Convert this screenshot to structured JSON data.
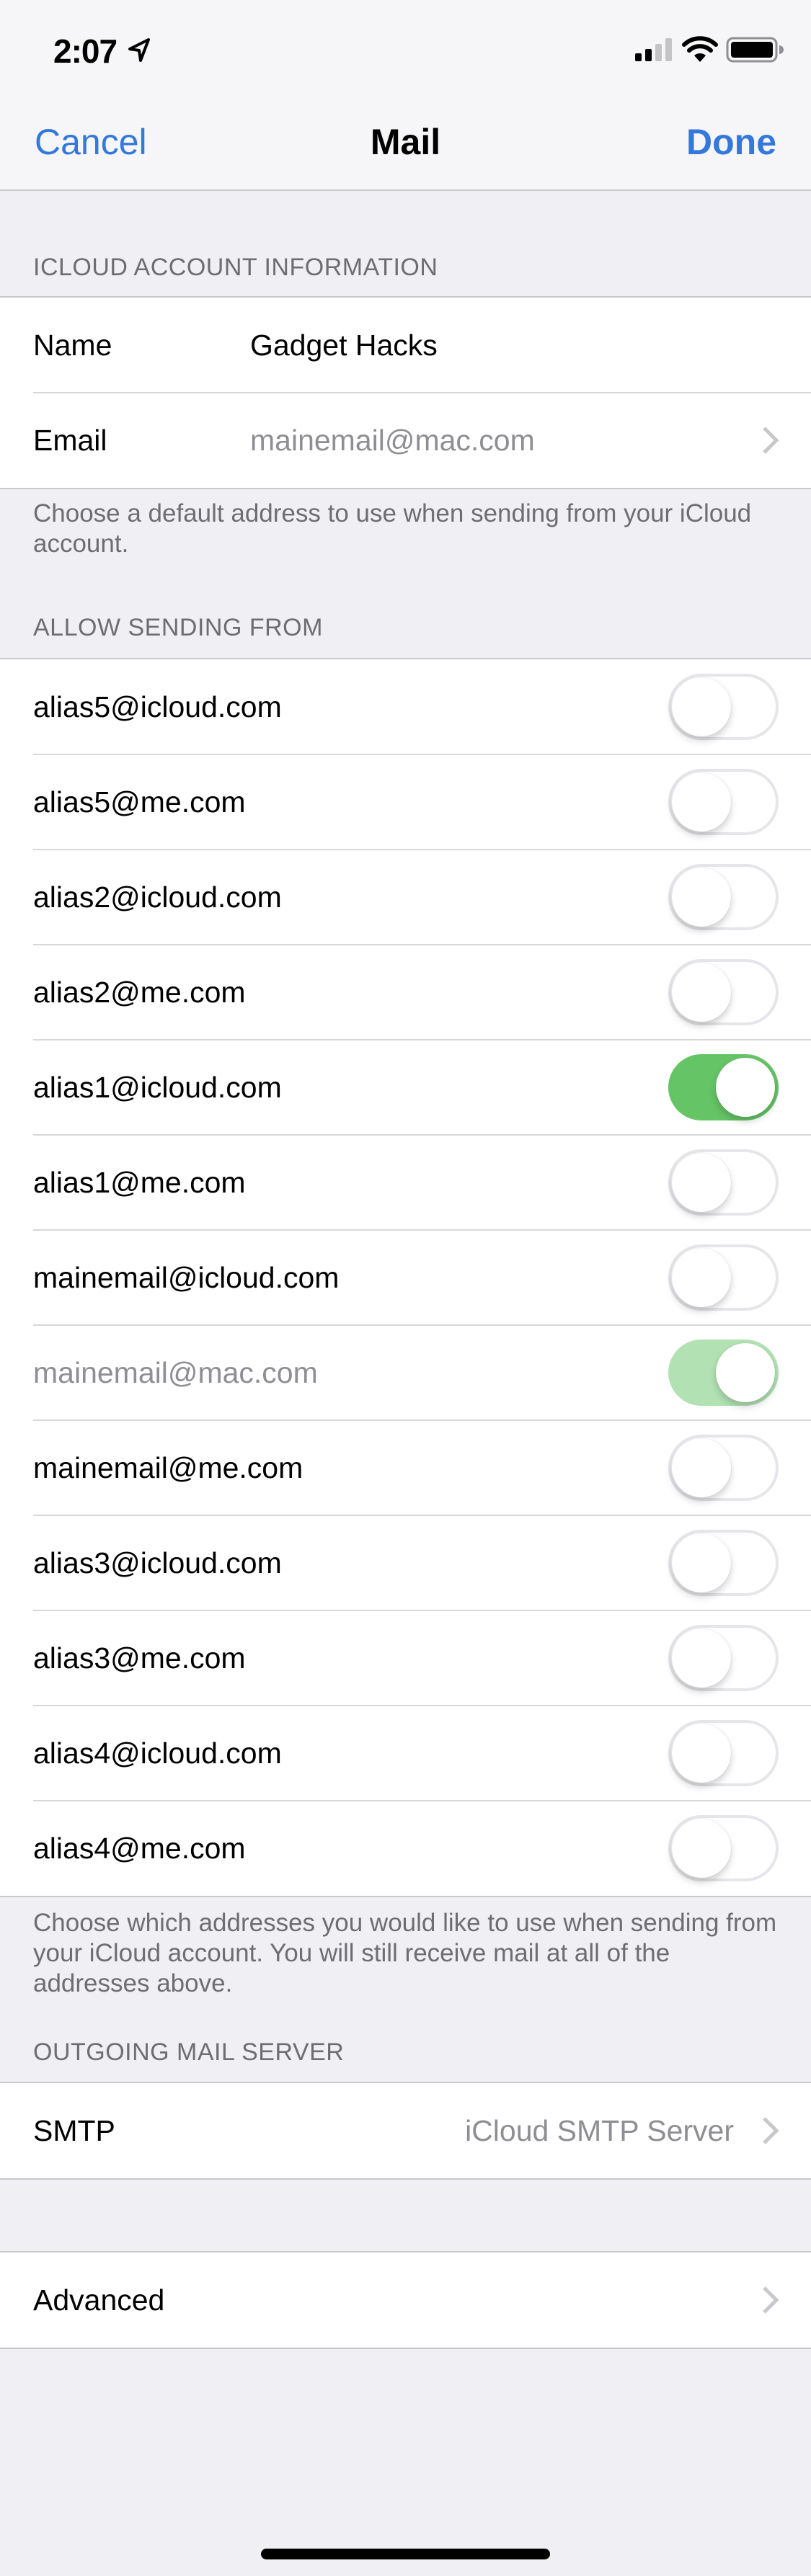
{
  "status_bar": {
    "time": "2:07",
    "location_icon": "location-arrow-icon",
    "signal_bars_filled": 2,
    "signal_bars_total": 4,
    "wifi_icon": "wifi-icon",
    "battery_icon": "battery-icon"
  },
  "nav": {
    "cancel_label": "Cancel",
    "title": "Mail",
    "done_label": "Done"
  },
  "colors": {
    "accent": "#3478DC",
    "toggle_on": "#65C466",
    "toggle_on_disabled": "#B2E2B3",
    "secondary_text": "#8E8E93",
    "header_text": "#6D6D72",
    "background": "#EFEFF4"
  },
  "account_section": {
    "header": "ICLOUD ACCOUNT INFORMATION",
    "name_label": "Name",
    "name_value": "Gadget Hacks",
    "email_label": "Email",
    "email_value": "mainemail@mac.com",
    "footer": "Choose a default address to use when sending from your iCloud account."
  },
  "sending_section": {
    "header": "ALLOW SENDING FROM",
    "addresses": [
      {
        "address": "alias5@icloud.com",
        "enabled": false,
        "disabled": false
      },
      {
        "address": "alias5@me.com",
        "enabled": false,
        "disabled": false
      },
      {
        "address": "alias2@icloud.com",
        "enabled": false,
        "disabled": false
      },
      {
        "address": "alias2@me.com",
        "enabled": false,
        "disabled": false
      },
      {
        "address": "alias1@icloud.com",
        "enabled": true,
        "disabled": false
      },
      {
        "address": "alias1@me.com",
        "enabled": false,
        "disabled": false
      },
      {
        "address": "mainemail@icloud.com",
        "enabled": false,
        "disabled": false
      },
      {
        "address": "mainemail@mac.com",
        "enabled": true,
        "disabled": true
      },
      {
        "address": "mainemail@me.com",
        "enabled": false,
        "disabled": false
      },
      {
        "address": "alias3@icloud.com",
        "enabled": false,
        "disabled": false
      },
      {
        "address": "alias3@me.com",
        "enabled": false,
        "disabled": false
      },
      {
        "address": "alias4@icloud.com",
        "enabled": false,
        "disabled": false
      },
      {
        "address": "alias4@me.com",
        "enabled": false,
        "disabled": false
      }
    ],
    "footer": "Choose which addresses you would like to use when sending from your iCloud account. You will still receive mail at all of the addresses above."
  },
  "outgoing_section": {
    "header": "OUTGOING MAIL SERVER",
    "smtp_label": "SMTP",
    "smtp_value": "iCloud SMTP Server"
  },
  "advanced": {
    "label": "Advanced"
  }
}
